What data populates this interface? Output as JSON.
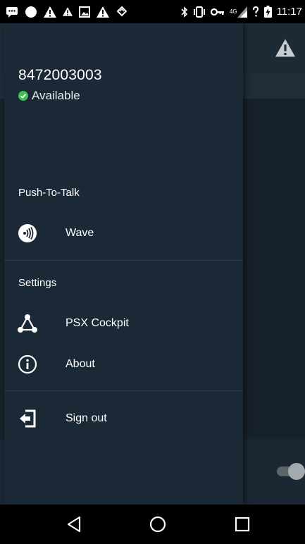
{
  "status_bar": {
    "time": "11:17",
    "network_type": "4G"
  },
  "drawer": {
    "phone_number": "8472003003",
    "presence_status": "Available",
    "sections": [
      {
        "label": "Push-To-Talk",
        "items": [
          {
            "label": "Wave",
            "icon": "wave-icon"
          }
        ]
      },
      {
        "label": "Settings",
        "items": [
          {
            "label": "PSX Cockpit",
            "icon": "network-nodes-icon"
          },
          {
            "label": "About",
            "icon": "info-icon"
          }
        ]
      }
    ],
    "sign_out": {
      "label": "Sign out",
      "icon": "sign-out-icon"
    }
  },
  "colors": {
    "drawer_bg": "#1b2937",
    "available_green": "#3fbf4f",
    "text": "#ffffff"
  }
}
